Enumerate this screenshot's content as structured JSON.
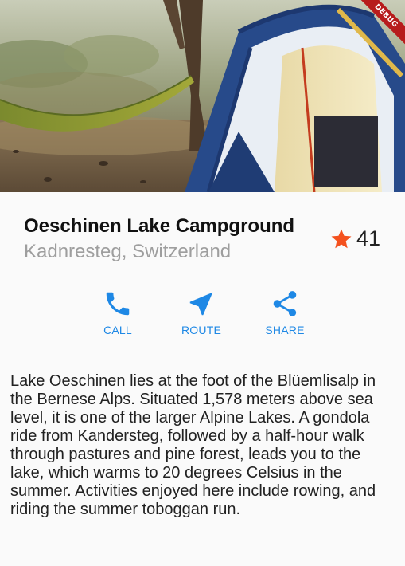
{
  "hero": {
    "image_description_icon": "camping-tent-hammock-photo"
  },
  "debug_banner": {
    "label": "DEBUG",
    "color": "#b71c1c"
  },
  "place": {
    "title": "Oeschinen Lake Campground",
    "location": "Kadnresteg, Switzerland"
  },
  "rating": {
    "icon": "star-icon",
    "count": "41",
    "color": "#f4511e"
  },
  "actions": {
    "accent_color": "#1e88e5",
    "call": {
      "label": "CALL",
      "icon": "phone-icon"
    },
    "route": {
      "label": "ROUTE",
      "icon": "navigation-arrow-icon"
    },
    "share": {
      "label": "SHARE",
      "icon": "share-icon"
    }
  },
  "description": "Lake Oeschinen lies at the foot of the Blüemlisalp in the Bernese Alps. Situated 1,578 meters above sea level, it is one of the larger Alpine Lakes. A gondola ride from Kandersteg, followed by a half-hour walk through pastures and pine forest, leads you to the lake, which warms to 20 degrees Celsius in the summer. Activities enjoyed here include rowing, and riding the summer toboggan run."
}
